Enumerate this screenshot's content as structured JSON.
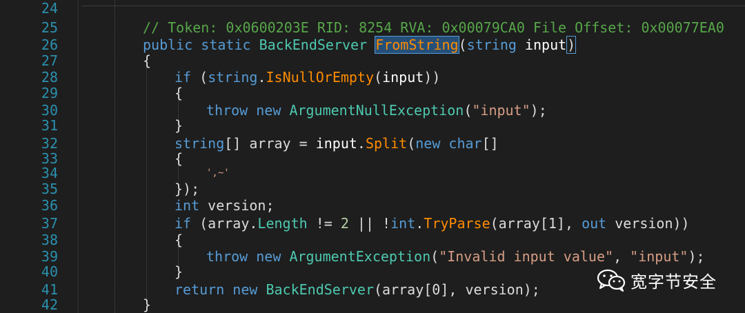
{
  "line_numbers": [
    "24",
    "25",
    "26",
    "27",
    "28",
    "29",
    "30",
    "31",
    "32",
    "33",
    "34",
    "35",
    "36",
    "37",
    "38",
    "39",
    "40",
    "41",
    "42"
  ],
  "code": {
    "l25": {
      "comment": "// Token: 0x0600203E RID: 8254 RVA: 0x00079CA0 File Offset: 0x00077EA0"
    },
    "l26": {
      "kw1": "public",
      "kw2": "static",
      "type": "BackEndServer",
      "method": "FromString",
      "open": "(",
      "kw3": "string",
      "param": "input",
      "close": ")"
    },
    "l27": {
      "brace": "{"
    },
    "l28": {
      "kw": "if",
      "p1": " (",
      "kw2": "string",
      "dot": ".",
      "method": "IsNullOrEmpty",
      "p2": "(",
      "param": "input",
      "p3": "))"
    },
    "l29": {
      "brace": "{"
    },
    "l30": {
      "kw": "throw",
      "kw2": "new",
      "type": "ArgumentNullException",
      "p1": "(",
      "str": "\"input\"",
      "p2": ");"
    },
    "l31": {
      "brace": "}"
    },
    "l32": {
      "kw": "string",
      "p1": "[] array = ",
      "param": "input",
      "dot": ".",
      "method": "Split",
      "p2": "(",
      "kw2": "new",
      "kw3": "char",
      "p3": "[]"
    },
    "l33": {
      "brace": "{"
    },
    "l34": {
      "chars": "',~'"
    },
    "l35": {
      "close": "});"
    },
    "l36": {
      "kw": "int",
      "rest": " version;"
    },
    "l37": {
      "kw": "if",
      "p1": " (array.",
      "prop": "Length",
      "p2": " != ",
      "num": "2",
      "p3": " || !",
      "kw2": "int",
      "dot": ".",
      "method": "TryParse",
      "p4": "(array[1], ",
      "kw3": "out",
      "p5": " version))"
    },
    "l38": {
      "brace": "{"
    },
    "l39": {
      "kw": "throw",
      "kw2": "new",
      "type": "ArgumentException",
      "p1": "(",
      "str1": "\"Invalid input value\"",
      "p2": ", ",
      "str2": "\"input\"",
      "p3": ");"
    },
    "l40": {
      "brace": "}"
    },
    "l41": {
      "kw": "return",
      "kw2": "new",
      "type": "BackEndServer",
      "rest": "(array[0], version);"
    },
    "l42": {
      "brace": "}"
    }
  },
  "watermark": {
    "text": "宽字节安全",
    "icon": "wechat-icon"
  },
  "colors": {
    "background": "#1e1e1e",
    "line_number": "#2b91af",
    "keyword": "#569cd6",
    "type": "#4ec9b0",
    "method": "#ff8c00",
    "comment": "#57a64a",
    "string": "#d69d85",
    "selection": "#264f78"
  }
}
